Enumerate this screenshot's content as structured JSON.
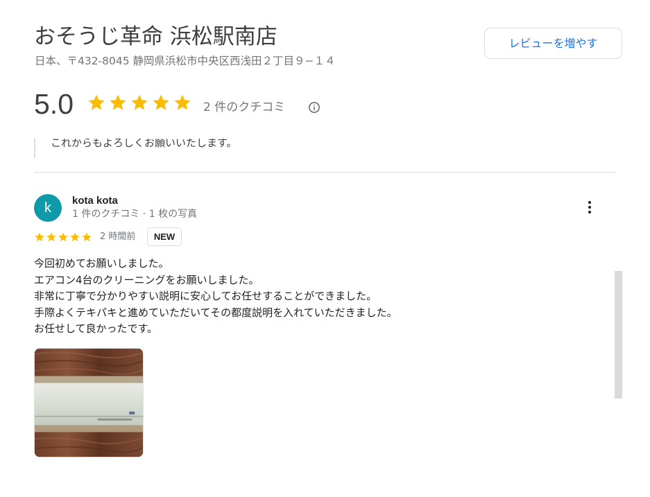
{
  "place": {
    "title": "おそうじ革命 浜松駅南店",
    "address": "日本、〒432-8045 静岡県浜松市中央区西浅田２丁目９−１４",
    "add_review_label": "レビューを増やす",
    "rating": "5.0",
    "review_count": "2 件のクチコミ",
    "star_color": "#fbbc04"
  },
  "previous_review": {
    "text": "これからもよろしくお願いいたします。"
  },
  "review": {
    "avatar_letter": "k",
    "avatar_color": "#0f9aaa",
    "reviewer_name": "kota kota",
    "reviewer_meta": "1 件のクチコミ · 1 枚の写真",
    "stars": 5,
    "time": "2 時間前",
    "badge": "NEW",
    "lines": [
      "今回初めてお願いしました。",
      "エアコン4台のクリーニングをお願いしました。",
      "非常に丁寧で分かりやすい説明に安心してお任せすることができました。",
      "手際よくテキパキと進めていただいてその都度説明を入れていただきました。",
      "お任せして良かったです。"
    ]
  },
  "icons": {
    "info": "info-icon",
    "more": "more-vert-icon",
    "star": "star-icon"
  }
}
